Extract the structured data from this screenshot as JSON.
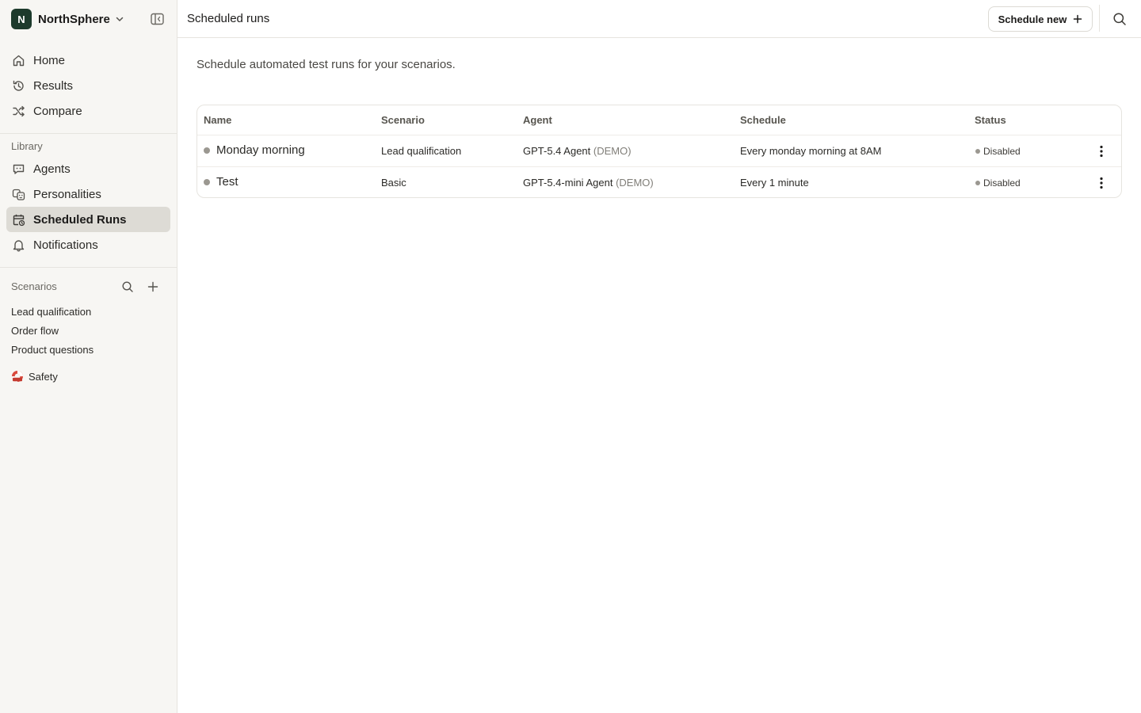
{
  "workspace": {
    "initial": "N",
    "name": "NorthSphere"
  },
  "nav": {
    "home": "Home",
    "results": "Results",
    "compare": "Compare",
    "library_label": "Library",
    "agents": "Agents",
    "personalities": "Personalities",
    "scheduled_runs": "Scheduled Runs",
    "notifications": "Notifications"
  },
  "scenarios": {
    "label": "Scenarios",
    "items": [
      "Lead qualification",
      "Order flow",
      "Product questions"
    ],
    "safety": "Safety"
  },
  "header": {
    "title": "Scheduled runs",
    "schedule_button": "Schedule new"
  },
  "page": {
    "subtitle": "Schedule automated test runs for your scenarios."
  },
  "table": {
    "columns": [
      "Name",
      "Scenario",
      "Agent",
      "Schedule",
      "Status"
    ],
    "rows": [
      {
        "name": "Monday morning",
        "scenario": "Lead qualification",
        "agent": "GPT-5.4 Agent",
        "agent_tag": "(DEMO)",
        "schedule": "Every monday morning at 8AM",
        "status": "Disabled"
      },
      {
        "name": "Test",
        "scenario": "Basic",
        "agent": "GPT-5.4-mini Agent",
        "agent_tag": "(DEMO)",
        "schedule": "Every 1 minute",
        "status": "Disabled"
      }
    ]
  },
  "colors": {
    "brand": "#1d3a2c",
    "sidebar_bg": "#f7f6f3",
    "active_bg": "#dddbd5",
    "status_dot": "#9b9891"
  }
}
